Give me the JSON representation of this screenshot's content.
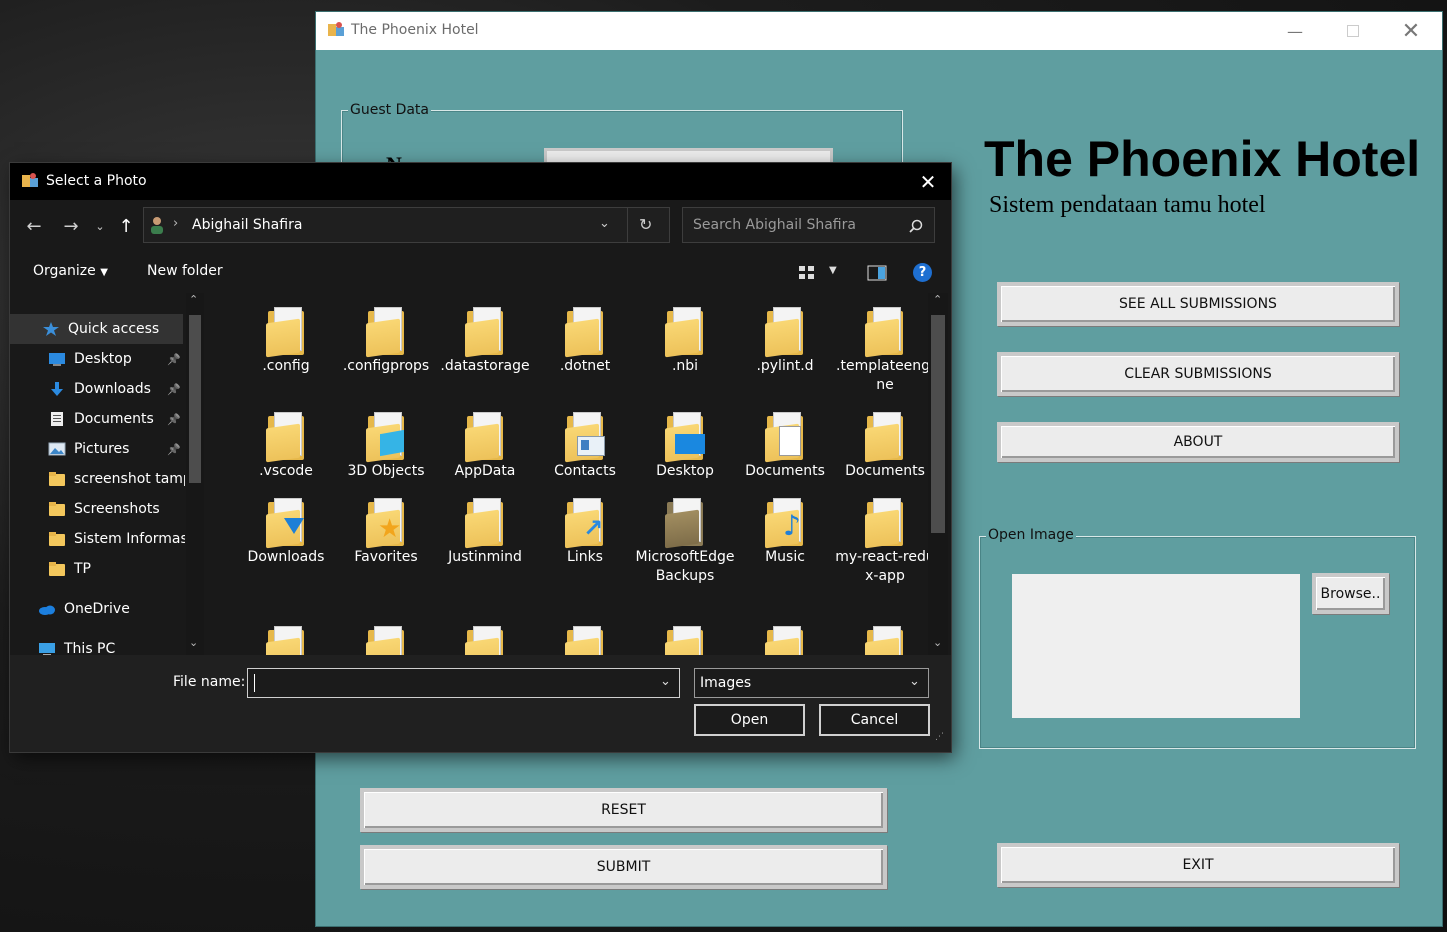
{
  "hotel": {
    "window_title": "The Phoenix Hotel",
    "guest_group_label": "Guest Data",
    "name_label_partial": "N",
    "heading": "The Phoenix Hotel",
    "subtitle": "Sistem pendataan tamu hotel",
    "buttons": {
      "see_all": "SEE ALL SUBMISSIONS",
      "clear": "CLEAR SUBMISSIONS",
      "about": "ABOUT",
      "reset": "RESET",
      "submit": "SUBMIT",
      "exit": "EXIT",
      "browse": "Browse.."
    },
    "open_image_label": "Open Image",
    "colors": {
      "window_bg": "#5f9ea0",
      "button_bg": "#ececec"
    }
  },
  "dialog": {
    "title": "Select a Photo",
    "breadcrumb": "Abighail Shafira",
    "search_placeholder": "Search Abighail Shafira",
    "organize": "Organize",
    "new_folder": "New folder",
    "nav": [
      {
        "label": "Quick access",
        "icon": "star-icon",
        "pinned": false
      },
      {
        "label": "Desktop",
        "icon": "desktop-icon",
        "pinned": true
      },
      {
        "label": "Downloads",
        "icon": "download-icon",
        "pinned": true
      },
      {
        "label": "Documents",
        "icon": "documents-icon",
        "pinned": true
      },
      {
        "label": "Pictures",
        "icon": "pictures-icon",
        "pinned": true
      },
      {
        "label": "screenshot tamp",
        "icon": "folder-icon",
        "pinned": false
      },
      {
        "label": "Screenshots",
        "icon": "folder-icon",
        "pinned": false
      },
      {
        "label": "Sistem Informas",
        "icon": "folder-icon",
        "pinned": false
      },
      {
        "label": "TP",
        "icon": "folder-icon",
        "pinned": false
      },
      {
        "label": "OneDrive",
        "icon": "cloud-icon",
        "pinned": false
      },
      {
        "label": "This PC",
        "icon": "computer-icon",
        "pinned": false
      }
    ],
    "files": [
      {
        "name": ".config",
        "type": "folder"
      },
      {
        "name": ".configprops",
        "type": "folder"
      },
      {
        "name": ".datastorage",
        "type": "folder"
      },
      {
        "name": ".dotnet",
        "type": "folder"
      },
      {
        "name": ".nbi",
        "type": "folder"
      },
      {
        "name": ".pylint.d",
        "type": "folder"
      },
      {
        "name": ".templateengine",
        "type": "folder"
      },
      {
        "name": ".vscode",
        "type": "folder"
      },
      {
        "name": "3D Objects",
        "type": "3d-objects"
      },
      {
        "name": "AppData",
        "type": "folder"
      },
      {
        "name": "Contacts",
        "type": "contacts"
      },
      {
        "name": "Desktop",
        "type": "desktop"
      },
      {
        "name": "Documents",
        "type": "documents"
      },
      {
        "name": "Documents",
        "type": "folder"
      },
      {
        "name": "Downloads",
        "type": "downloads"
      },
      {
        "name": "Favorites",
        "type": "favorites"
      },
      {
        "name": "Justinmind",
        "type": "folder"
      },
      {
        "name": "Links",
        "type": "links"
      },
      {
        "name": "MicrosoftEdgeBackups",
        "type": "folder-dark"
      },
      {
        "name": "Music",
        "type": "music"
      },
      {
        "name": "my-react-redux-app",
        "type": "folder"
      }
    ],
    "file_name_label": "File name:",
    "file_name_value": "",
    "file_type": "Images",
    "open": "Open",
    "cancel": "Cancel"
  }
}
